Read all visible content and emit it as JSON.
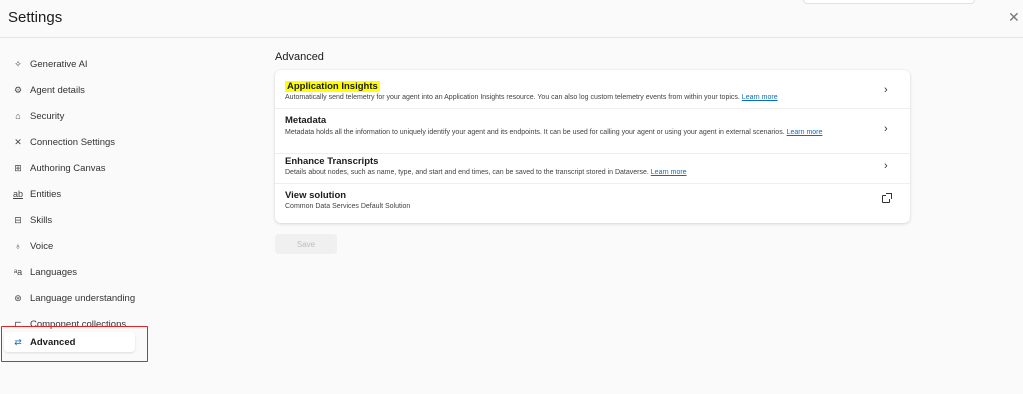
{
  "header": {
    "title": "Settings",
    "close_icon": "close-icon"
  },
  "sidebar": {
    "items": [
      {
        "label": "Generative AI",
        "icon": "sparkle-icon"
      },
      {
        "label": "Agent details",
        "icon": "bot-icon"
      },
      {
        "label": "Security",
        "icon": "lock-icon"
      },
      {
        "label": "Connection Settings",
        "icon": "plug-icon"
      },
      {
        "label": "Authoring Canvas",
        "icon": "grid-icon"
      },
      {
        "label": "Entities",
        "icon": "entity-icon"
      },
      {
        "label": "Skills",
        "icon": "toolbox-icon"
      },
      {
        "label": "Voice",
        "icon": "voice-icon"
      },
      {
        "label": "Languages",
        "icon": "translate-icon"
      },
      {
        "label": "Language understanding",
        "icon": "brain-icon"
      },
      {
        "label": "Component collections",
        "icon": "collection-icon"
      }
    ],
    "active": {
      "label": "Advanced",
      "icon": "sliders-icon"
    }
  },
  "main": {
    "section_title": "Advanced",
    "rows": [
      {
        "title": "Application Insights",
        "description": "Automatically send telemetry for your agent into an Application Insights resource. You can also log custom telemetry events from within your topics.",
        "link": "Learn more",
        "action_icon": "chevron-right-icon"
      },
      {
        "title": "Metadata",
        "description": "Metadata holds all the information to uniquely identify your agent and its endpoints. It can be used for calling your agent or using your agent in external scenarios.",
        "link": "Learn more",
        "action_icon": "chevron-right-icon"
      },
      {
        "title": "Enhance Transcripts",
        "description": "Details about nodes, such as name, type, and start and end times, can be saved to the transcript stored in Dataverse.",
        "link": "Learn more",
        "action_icon": "chevron-right-icon"
      },
      {
        "title": "View solution",
        "description": "Common Data Services Default Solution",
        "action_icon": "open-external-icon"
      }
    ],
    "save_label": "Save"
  },
  "colors": {
    "accent": "#0f6cbd",
    "highlight": "#ffff00",
    "focus_outline": "#e02424"
  }
}
